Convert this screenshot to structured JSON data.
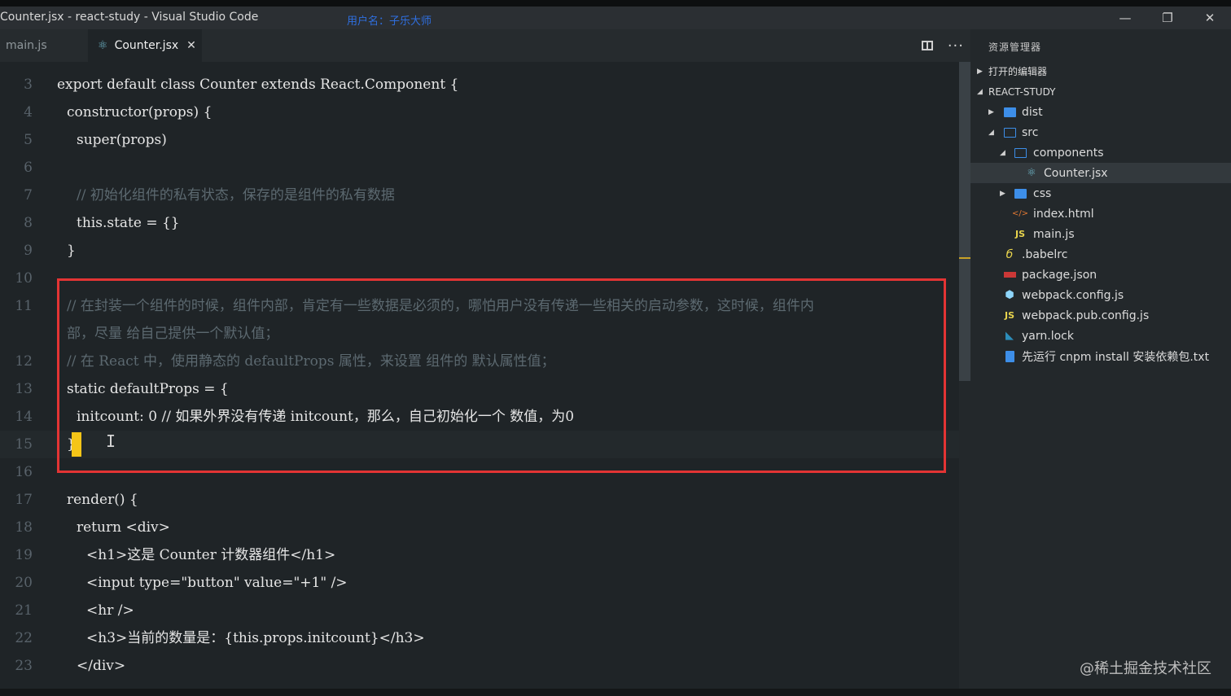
{
  "window": {
    "title": "Counter.jsx - react-study - Visual Studio Code",
    "user_watermark": "用户名：子乐大师",
    "controls": [
      "—",
      "❐",
      "✕"
    ]
  },
  "tabs": [
    {
      "label": "main.js",
      "active": false
    },
    {
      "label": "Counter.jsx",
      "active": true,
      "close": "✕"
    }
  ],
  "editor_actions": {
    "split_icon": "split-editor-icon",
    "more": "···"
  },
  "code_lines": [
    {
      "num": "3",
      "text": "export default class Counter extends React.Component {"
    },
    {
      "num": "4",
      "text": "constructor(props) {"
    },
    {
      "num": "5",
      "text": "super(props)"
    },
    {
      "num": "6",
      "text": ""
    },
    {
      "num": "7",
      "text": "// 初始化组件的私有状态，保存的是组件的私有数据"
    },
    {
      "num": "8",
      "text": "this.state = {}"
    },
    {
      "num": "9",
      "text": "}"
    },
    {
      "num": "10",
      "text": ""
    },
    {
      "num": "11",
      "text": "// 在封装一个组件的时候，组件内部，肯定有一些数据是必须的，哪怕用户没有传递一些相关的启动参数，这时候，组件内"
    },
    {
      "num": "",
      "text": "部，尽量 给自己提供一个默认值；"
    },
    {
      "num": "12",
      "text": "// 在 React 中，使用静态的 defaultProps 属性，来设置 组件的 默认属性值；"
    },
    {
      "num": "13",
      "text": "static defaultProps = {"
    },
    {
      "num": "14",
      "text": "initcount: 0 // 如果外界没有传递 initcount，那么，自己初始化一个 数值，为0"
    },
    {
      "num": "15",
      "text": "}"
    },
    {
      "num": "16",
      "text": ""
    },
    {
      "num": "17",
      "text": "render() {"
    },
    {
      "num": "18",
      "text": "return <div>"
    },
    {
      "num": "19",
      "text": "<h1>这是 Counter 计数器组件</h1>"
    },
    {
      "num": "20",
      "text": "<input type=\"button\" value=\"+1\" />"
    },
    {
      "num": "21",
      "text": "<hr />"
    },
    {
      "num": "22",
      "text": "<h3>当前的数量是：{this.props.initcount}</h3>"
    },
    {
      "num": "23",
      "text": "</div>"
    }
  ],
  "explorer": {
    "title": "资源管理器",
    "sections": {
      "open_editors": "打开的编辑器",
      "project": "REACT-STUDY"
    },
    "items": [
      {
        "label": "dist",
        "icon": "folder-icon"
      },
      {
        "label": "src",
        "icon": "folder-open-icon"
      },
      {
        "label": "components",
        "icon": "folder-open-icon"
      },
      {
        "label": "Counter.jsx",
        "icon": "react-icon"
      },
      {
        "label": "css",
        "icon": "folder-icon"
      },
      {
        "label": "index.html",
        "icon": "html-icon"
      },
      {
        "label": "main.js",
        "icon": "js-icon"
      },
      {
        "label": ".babelrc",
        "icon": "babel-icon"
      },
      {
        "label": "package.json",
        "icon": "npm-icon"
      },
      {
        "label": "webpack.config.js",
        "icon": "webpack-icon"
      },
      {
        "label": "webpack.pub.config.js",
        "icon": "js-icon"
      },
      {
        "label": "yarn.lock",
        "icon": "yarn-icon"
      },
      {
        "label": "先运行 cnpm install 安装依赖包.txt",
        "icon": "file-icon"
      }
    ]
  },
  "site_watermark": "@稀土掘金技术社区",
  "colors": {
    "highlight_box": "#e33434",
    "cursor": "#f5c518",
    "accent_folder": "#3d8ee8"
  }
}
